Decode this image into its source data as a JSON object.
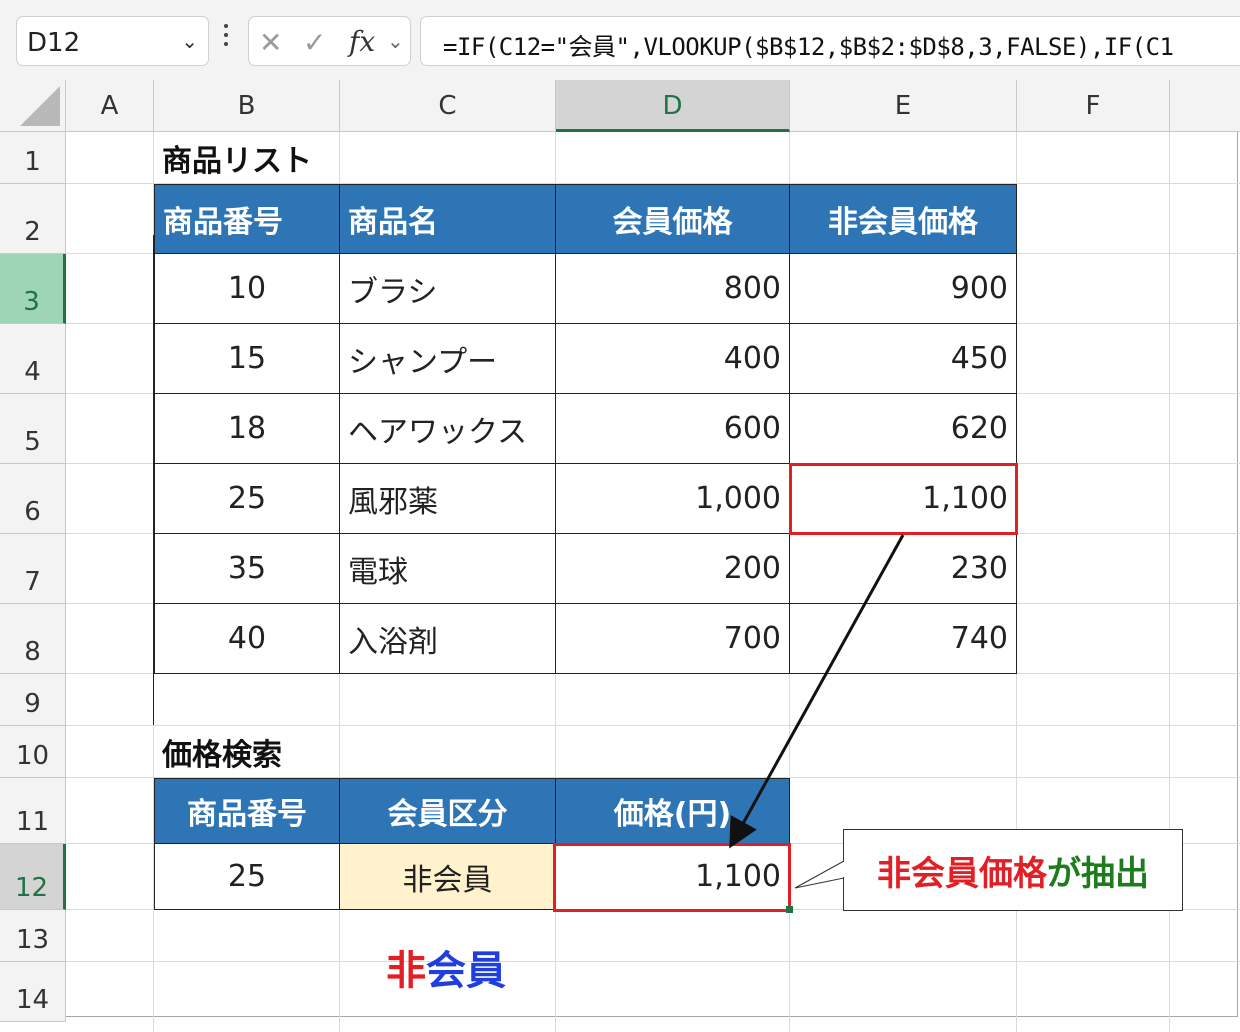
{
  "formula_bar": {
    "name_box": "D12",
    "formula": "=IF(C12=\"会員\",VLOOKUP($B$12,$B$2:$D$8,3,FALSE),IF(C1"
  },
  "columns": [
    "A",
    "B",
    "C",
    "D",
    "E",
    "F"
  ],
  "rows": [
    "1",
    "2",
    "3",
    "4",
    "5",
    "6",
    "7",
    "8",
    "9",
    "10",
    "11",
    "12",
    "13",
    "14"
  ],
  "product_list": {
    "title": "商品リスト",
    "headers": [
      "商品番号",
      "商品名",
      "会員価格",
      "非会員価格"
    ],
    "rows": [
      [
        "10",
        "ブラシ",
        "800",
        "900"
      ],
      [
        "15",
        "シャンプー",
        "400",
        "450"
      ],
      [
        "18",
        "ヘアワックス",
        "600",
        "620"
      ],
      [
        "25",
        "風邪薬",
        "1,000",
        "1,100"
      ],
      [
        "35",
        "電球",
        "200",
        "230"
      ],
      [
        "40",
        "入浴剤",
        "700",
        "740"
      ]
    ]
  },
  "price_search": {
    "title": "価格検索",
    "headers": [
      "商品番号",
      "会員区分",
      "価格(円)"
    ],
    "values": [
      "25",
      "非会員",
      "1,100"
    ]
  },
  "annotations": {
    "callout_part1": "非会員価格",
    "callout_part2": "が抽出",
    "big_part1": "非",
    "big_part2": "会員",
    "color_red": "#e31f26",
    "color_green": "#1e7b1e",
    "color_blue": "#1f3ee0"
  },
  "colors": {
    "header_fill": "#2e75b6",
    "input_fill": "#fff2cc",
    "excel_green": "#217346"
  }
}
